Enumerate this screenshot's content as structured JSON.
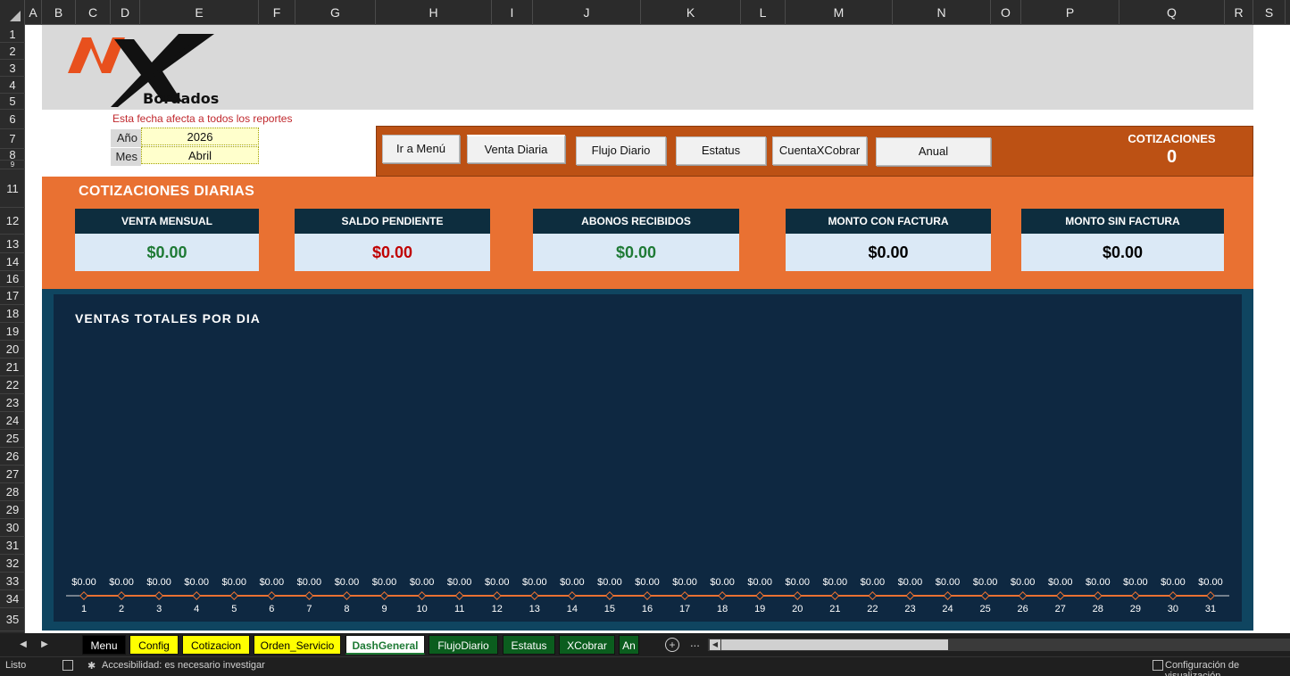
{
  "columns": [
    "A",
    "B",
    "C",
    "D",
    "E",
    "F",
    "G",
    "H",
    "I",
    "J",
    "K",
    "L",
    "M",
    "N",
    "O",
    "P",
    "Q",
    "R",
    "S"
  ],
  "rows": [
    "1",
    "2",
    "3",
    "4",
    "5",
    "6",
    "7",
    "8",
    "9",
    "11",
    "12",
    "13",
    "14",
    "16",
    "17",
    "18",
    "19",
    "20",
    "21",
    "22",
    "23",
    "24",
    "25",
    "26",
    "27",
    "28",
    "29",
    "30",
    "31",
    "32",
    "33",
    "34",
    "35"
  ],
  "logo": {
    "brand_text": "Bordados",
    "mark": "NX"
  },
  "filters": {
    "note": "Esta fecha afecta a todos los reportes",
    "year_label": "Año",
    "year_value": "2026",
    "month_label": "Mes",
    "month_value": "Abril"
  },
  "nav": {
    "buttons": [
      "Ir a Menú",
      "Venta Diaria",
      "Flujo Diario",
      "Estatus",
      "CuentaXCobrar",
      "Anual"
    ],
    "cotizaciones_label": "COTIZACIONES",
    "cotizaciones_value": "0"
  },
  "kpis": {
    "title": "COTIZACIONES DIARIAS",
    "cards": [
      {
        "label": "VENTA MENSUAL",
        "value": "$0.00",
        "color": "#1e7a35"
      },
      {
        "label": "SALDO PENDIENTE",
        "value": "$0.00",
        "color": "#c00000"
      },
      {
        "label": "ABONOS RECIBIDOS",
        "value": "$0.00",
        "color": "#1e7a35"
      },
      {
        "label": "MONTO CON FACTURA",
        "value": "$0.00",
        "color": "#000000"
      },
      {
        "label": "MONTO SIN FACTURA",
        "value": "$0.00",
        "color": "#000000"
      }
    ]
  },
  "chart_data": {
    "type": "line",
    "title": "VENTAS TOTALES POR DIA",
    "x": [
      1,
      2,
      3,
      4,
      5,
      6,
      7,
      8,
      9,
      10,
      11,
      12,
      13,
      14,
      15,
      16,
      17,
      18,
      19,
      20,
      21,
      22,
      23,
      24,
      25,
      26,
      27,
      28,
      29,
      30,
      31
    ],
    "series": [
      {
        "values": [
          0,
          0,
          0,
          0,
          0,
          0,
          0,
          0,
          0,
          0,
          0,
          0,
          0,
          0,
          0,
          0,
          0,
          0,
          0,
          0,
          0,
          0,
          0,
          0,
          0,
          0,
          0,
          0,
          0,
          0,
          0
        ],
        "color": "#e97132"
      }
    ],
    "data_labels": [
      "$0.00",
      "$0.00",
      "$0.00",
      "$0.00",
      "$0.00",
      "$0.00",
      "$0.00",
      "$0.00",
      "$0.00",
      "$0.00",
      "$0.00",
      "$0.00",
      "$0.00",
      "$0.00",
      "$0.00",
      "$0.00",
      "$0.00",
      "$0.00",
      "$0.00",
      "$0.00",
      "$0.00",
      "$0.00",
      "$0.00",
      "$0.00",
      "$0.00",
      "$0.00",
      "$0.00",
      "$0.00",
      "$0.00",
      "$0.00",
      "$0.00"
    ],
    "grid": false
  },
  "sheet_tabs": [
    {
      "label": "Menu",
      "bg": "#000000",
      "fg": "#ffffff"
    },
    {
      "label": "Config",
      "bg": "#ffff00",
      "fg": "#000000"
    },
    {
      "label": "Cotizacion",
      "bg": "#ffff00",
      "fg": "#000000"
    },
    {
      "label": "Orden_Servicio",
      "bg": "#ffff00",
      "fg": "#000000"
    },
    {
      "label": "DashGeneral",
      "bg": "#ffffff",
      "fg": "#1e7a35",
      "active": true
    },
    {
      "label": "FlujoDiario",
      "bg": "#0b5d1e",
      "fg": "#ffffff"
    },
    {
      "label": "Estatus",
      "bg": "#0b5d1e",
      "fg": "#ffffff"
    },
    {
      "label": "XCobrar",
      "bg": "#0b5d1e",
      "fg": "#ffffff"
    },
    {
      "label": "An",
      "bg": "#0b5d1e",
      "fg": "#ffffff"
    }
  ],
  "tabs_more": "...",
  "statusbar": {
    "ready": "Listo",
    "accessibility": "Accesibilidad: es necesario investigar",
    "view_settings": "Configuración de visualización"
  }
}
